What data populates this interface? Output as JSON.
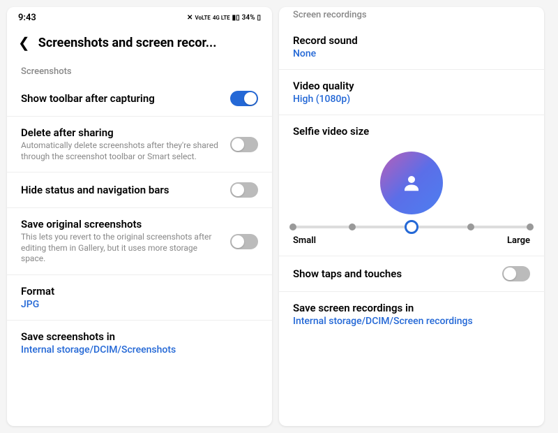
{
  "statusBar": {
    "time": "9:43",
    "battery": "34%"
  },
  "left": {
    "headerTitle": "Screenshots and screen recor...",
    "sectionLabel": "Screenshots",
    "items": {
      "showToolbar": {
        "title": "Show toolbar after capturing"
      },
      "deleteAfterSharing": {
        "title": "Delete after sharing",
        "sub": "Automatically delete screenshots after they're shared through the screenshot toolbar or Smart select."
      },
      "hideBars": {
        "title": "Hide status and navigation bars"
      },
      "saveOriginal": {
        "title": "Save original screenshots",
        "sub": "This lets you revert to the original screenshots after editing them in Gallery, but it uses more storage space."
      },
      "format": {
        "title": "Format",
        "value": "JPG"
      },
      "saveIn": {
        "title": "Save screenshots in",
        "value": "Internal storage/DCIM/Screenshots"
      }
    }
  },
  "right": {
    "sectionLabel": "Screen recordings",
    "items": {
      "recordSound": {
        "title": "Record sound",
        "value": "None"
      },
      "videoQuality": {
        "title": "Video quality",
        "value": "High (1080p)"
      },
      "selfieSize": {
        "title": "Selfie video size",
        "labelSmall": "Small",
        "labelLarge": "Large"
      },
      "showTaps": {
        "title": "Show taps and touches"
      },
      "saveIn": {
        "title": "Save screen recordings in",
        "value": "Internal storage/DCIM/Screen recordings"
      }
    }
  }
}
